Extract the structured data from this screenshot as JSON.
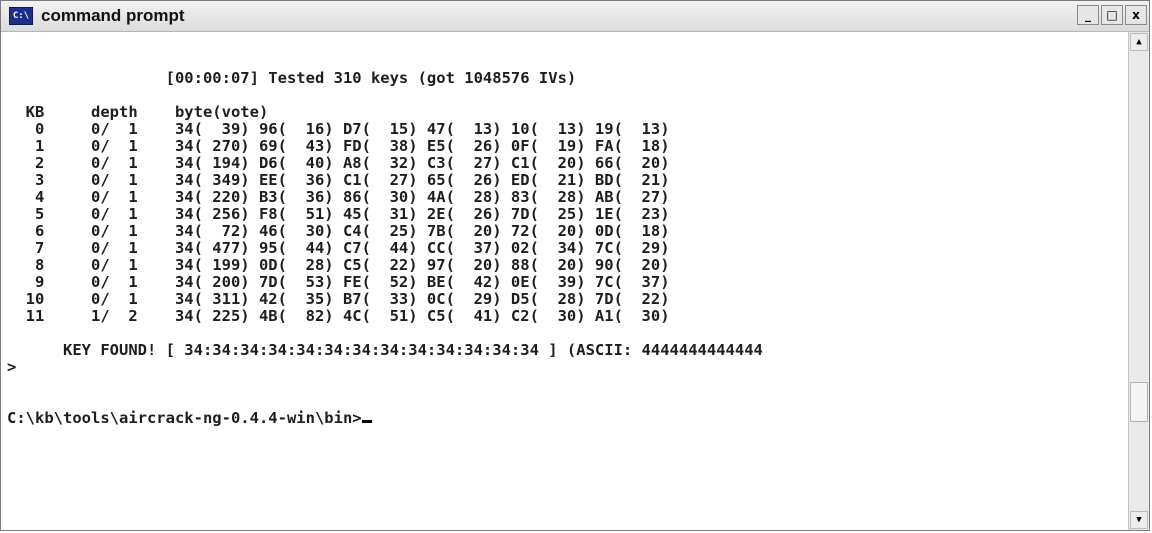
{
  "window": {
    "title": "command prompt",
    "icon": "console-icon",
    "icon_text": "C:\\",
    "minimize_label": "_",
    "maximize_label": "□",
    "close_label": "x"
  },
  "terminal": {
    "lines": [
      "",
      "",
      "                 [00:00:07] Tested 310 keys (got 1048576 IVs)",
      "",
      "  KB     depth    byte(vote)",
      "   0     0/  1    34(  39) 96(  16) D7(  15) 47(  13) 10(  13) 19(  13)",
      "   1     0/  1    34( 270) 69(  43) FD(  38) E5(  26) 0F(  19) FA(  18)",
      "   2     0/  1    34( 194) D6(  40) A8(  32) C3(  27) C1(  20) 66(  20)",
      "   3     0/  1    34( 349) EE(  36) C1(  27) 65(  26) ED(  21) BD(  21)",
      "   4     0/  1    34( 220) B3(  36) 86(  30) 4A(  28) 83(  28) AB(  27)",
      "   5     0/  1    34( 256) F8(  51) 45(  31) 2E(  26) 7D(  25) 1E(  23)",
      "   6     0/  1    34(  72) 46(  30) C4(  25) 7B(  20) 72(  20) 0D(  18)",
      "   7     0/  1    34( 477) 95(  44) C7(  44) CC(  37) 02(  34) 7C(  29)",
      "   8     0/  1    34( 199) 0D(  28) C5(  22) 97(  20) 88(  20) 90(  20)",
      "   9     0/  1    34( 200) 7D(  53) FE(  52) BE(  42) 0E(  39) 7C(  37)",
      "  10     0/  1    34( 311) 42(  35) B7(  33) 0C(  29) D5(  28) 7D(  22)",
      "  11     1/  2    34( 225) 4B(  82) 4C(  51) C5(  41) C2(  30) A1(  30)",
      "",
      "      KEY FOUND! [ 34:34:34:34:34:34:34:34:34:34:34:34:34 ] (ASCII: 4444444444444",
      ">",
      "",
      "",
      "C:\\kb\\tools\\aircrack-ng-0.4.4-win\\bin>"
    ]
  },
  "scrollbar": {
    "up_icon": "▲",
    "down_icon": "▼"
  }
}
